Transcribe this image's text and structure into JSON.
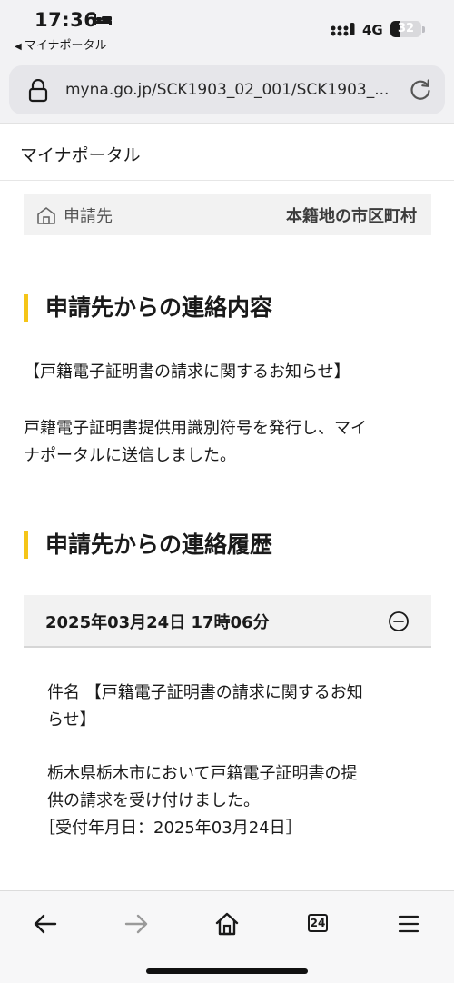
{
  "status_bar": {
    "time": "17:36",
    "back_app": "マイナポータル",
    "network": "4G",
    "battery": 32
  },
  "address_bar": {
    "url": "myna.go.jp/SCK1903_02_001/SCK1903_..."
  },
  "site": {
    "title": "マイナポータル"
  },
  "destination": {
    "label": "申請先",
    "value": "本籍地の市区町村"
  },
  "contact_section": {
    "title": "申請先からの連絡内容",
    "subject": "【戸籍電子証明書の請求に関するお知らせ】",
    "body_line1": "戸籍電子証明書提供用識別符号を発行し、マイ",
    "body_line2": "ナポータルに送信しました。"
  },
  "history_section": {
    "title": "申請先からの連絡履歴",
    "entry": {
      "datetime": "2025年03月24日 17時06分",
      "subject_line1": "件名 【戸籍電子証明書の請求に関するお知",
      "subject_line2": "らせ】",
      "body_line1": "栃木県栃木市において戸籍電子証明書の提",
      "body_line2": "供の請求を受け付けました。",
      "body_line3": "［受付年月日：2025年03月24日］"
    }
  },
  "toolbar": {
    "tab_count": "24",
    "icons": [
      "back-arrow-icon",
      "forward-arrow-icon",
      "home-icon",
      "tabs-icon",
      "menu-icon"
    ]
  },
  "colors": {
    "accent": "#f5c518",
    "panel_bg": "#f2f2f2",
    "chrome_bg": "#f2f2f4"
  }
}
